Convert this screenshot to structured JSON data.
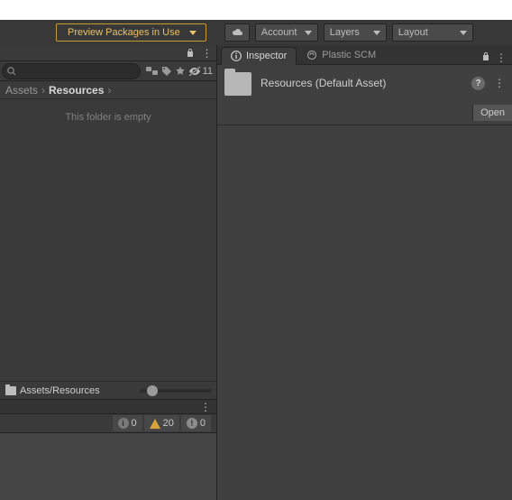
{
  "toolbar": {
    "preview_label": "Preview Packages in Use",
    "account_label": "Account",
    "layers_label": "Layers",
    "layout_label": "Layout"
  },
  "project": {
    "hidden_count": "11",
    "breadcrumb": {
      "root": "Assets",
      "current": "Resources"
    },
    "empty_msg": "This folder is empty",
    "path": "Assets/Resources"
  },
  "console": {
    "info": "0",
    "warn": "20",
    "error": "0"
  },
  "tabs": {
    "inspector": "Inspector",
    "plastic": "Plastic SCM"
  },
  "inspector": {
    "asset_title": "Resources (Default Asset)",
    "open_label": "Open"
  }
}
